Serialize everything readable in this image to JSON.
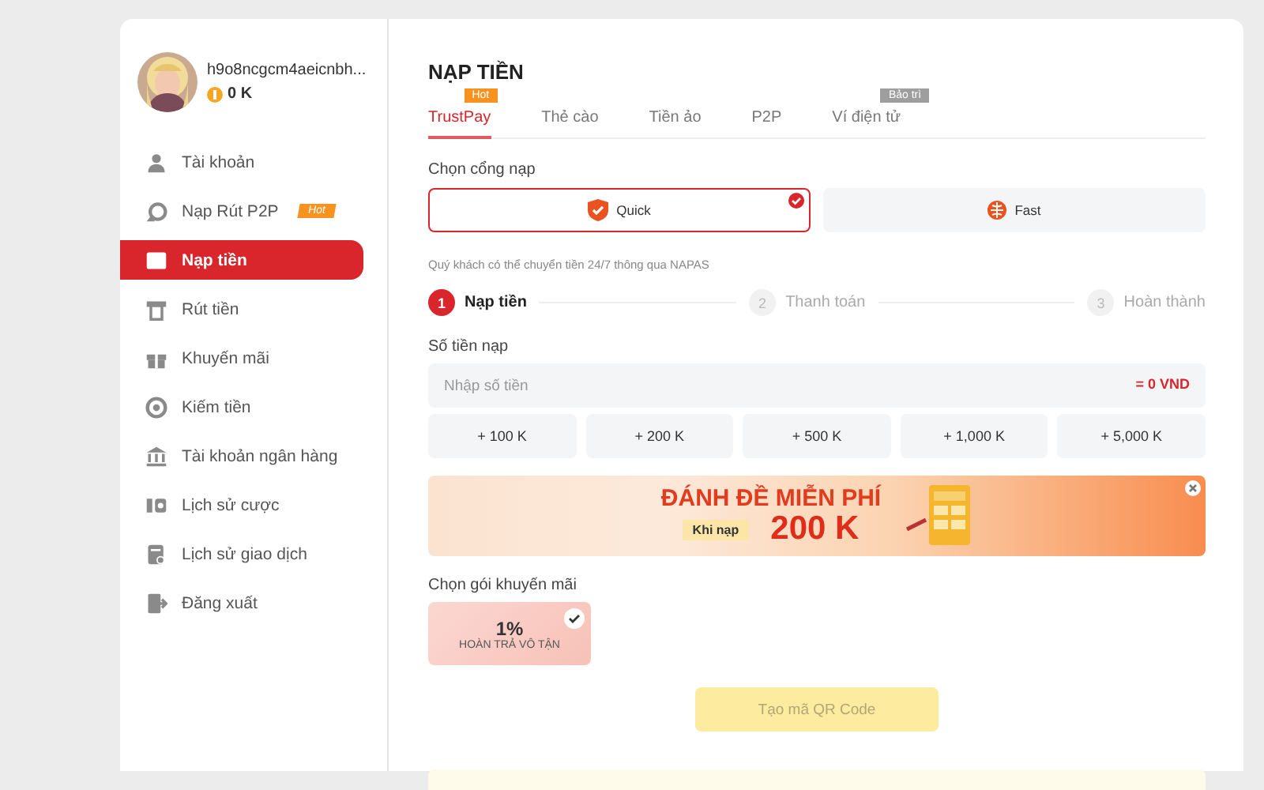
{
  "profile": {
    "username": "h9o8ncgcm4aeicnbh...",
    "balance": "0 K"
  },
  "menu": [
    {
      "label": "Tài khoản",
      "selected": false
    },
    {
      "label": "Nạp Rút P2P",
      "selected": false,
      "badge": {
        "text": "Hot",
        "color": "#f7931e"
      }
    },
    {
      "label": "Nạp tiền",
      "selected": true
    },
    {
      "label": "Rút tiền",
      "selected": false
    },
    {
      "label": "Khuyến mãi",
      "selected": false
    },
    {
      "label": "Kiếm tiền",
      "selected": false
    },
    {
      "label": "Tài khoản ngân hàng",
      "selected": false
    },
    {
      "label": "Lịch sử cược",
      "selected": false
    },
    {
      "label": "Lịch sử giao dịch",
      "selected": false
    },
    {
      "label": "Đăng xuất",
      "selected": false
    }
  ],
  "title": "NẠP TIỀN",
  "tabs": [
    {
      "label": "TrustPay",
      "selected": true,
      "badge": {
        "text": "Hot",
        "color": "#f7931e"
      }
    },
    {
      "label": "Thẻ cào",
      "selected": false
    },
    {
      "label": "Tiền ảo",
      "selected": false
    },
    {
      "label": "P2P",
      "selected": false
    },
    {
      "label": "Ví điện tử",
      "selected": false,
      "badge": {
        "text": "Bảo trì",
        "color": "#9e9e9e"
      }
    }
  ],
  "gateway_label": "Chọn cổng nạp",
  "gateways": [
    {
      "label": "Quick",
      "selected": true
    },
    {
      "label": "Fast",
      "selected": false
    }
  ],
  "note": "Quý khách có thể chuyển tiền 24/7 thông qua NAPAS",
  "steps": [
    {
      "number": "1",
      "label": "Nạp tiền",
      "selected": true
    },
    {
      "number": "2",
      "label": "Thanh toán",
      "selected": false
    },
    {
      "number": "3",
      "label": "Hoàn thành",
      "selected": false
    }
  ],
  "amount": {
    "label": "Số tiền nạp",
    "placeholder": "Nhập số tiền",
    "converted": "= 0 VND"
  },
  "quick_amounts": [
    "+ 100 K",
    "+ 200 K",
    "+ 500 K",
    "+ 1,000 K",
    "+ 5,000 K"
  ],
  "banner": {
    "headline": "ĐÁNH ĐỀ MIỄN PHÍ",
    "caption": "Khi nạp",
    "value": "200 K"
  },
  "promo_label": "Chọn gói khuyến mãi",
  "promos": [
    {
      "value": "1%",
      "label": "HOÀN TRẢ VÔ TẬN",
      "selected": true
    }
  ],
  "qr_button": {
    "label": "Tạo mã QR Code",
    "disabled": true
  }
}
